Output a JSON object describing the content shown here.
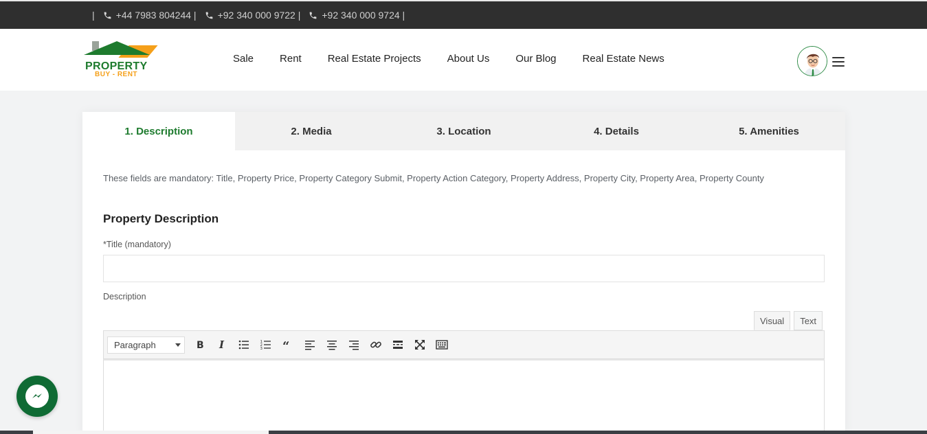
{
  "topbar": {
    "separator": "|",
    "phones": [
      "+44 7983 804244 |",
      "+92 340 000 9722 |",
      "+92 340 000 9724 |"
    ],
    "icon": "phone-icon"
  },
  "logo": {
    "line1": "PROPERTY",
    "line2": "BUY - RENT",
    "colors": {
      "green": "#1e7b2e",
      "orange": "#f5a01a"
    }
  },
  "nav": {
    "items": [
      "Sale",
      "Rent",
      "Real Estate Projects",
      "About Us",
      "Our Blog",
      "Real Estate News"
    ]
  },
  "tabs": [
    {
      "label": "1. Description",
      "active": true
    },
    {
      "label": "2. Media",
      "active": false
    },
    {
      "label": "3. Location",
      "active": false
    },
    {
      "label": "4. Details",
      "active": false
    },
    {
      "label": "5. Amenities",
      "active": false
    }
  ],
  "form": {
    "notice": "These fields are mandatory: Title, Property Price, Property Category Submit, Property Action Category, Property Address, Property City, Property Area, Property County",
    "section_title": "Property Description",
    "title_label": "*Title (mandatory)",
    "title_value": "",
    "description_label": "Description",
    "mode_visual": "Visual",
    "mode_text": "Text",
    "format_value": "Paragraph",
    "toolbar_icons": [
      "bold-icon",
      "italic-icon",
      "bullet-list-icon",
      "numbered-list-icon",
      "blockquote-icon",
      "align-left-icon",
      "align-center-icon",
      "align-right-icon",
      "link-icon",
      "read-more-icon",
      "fullscreen-icon",
      "toolbar-toggle-icon"
    ]
  },
  "accent_color": "#1e7b2e"
}
